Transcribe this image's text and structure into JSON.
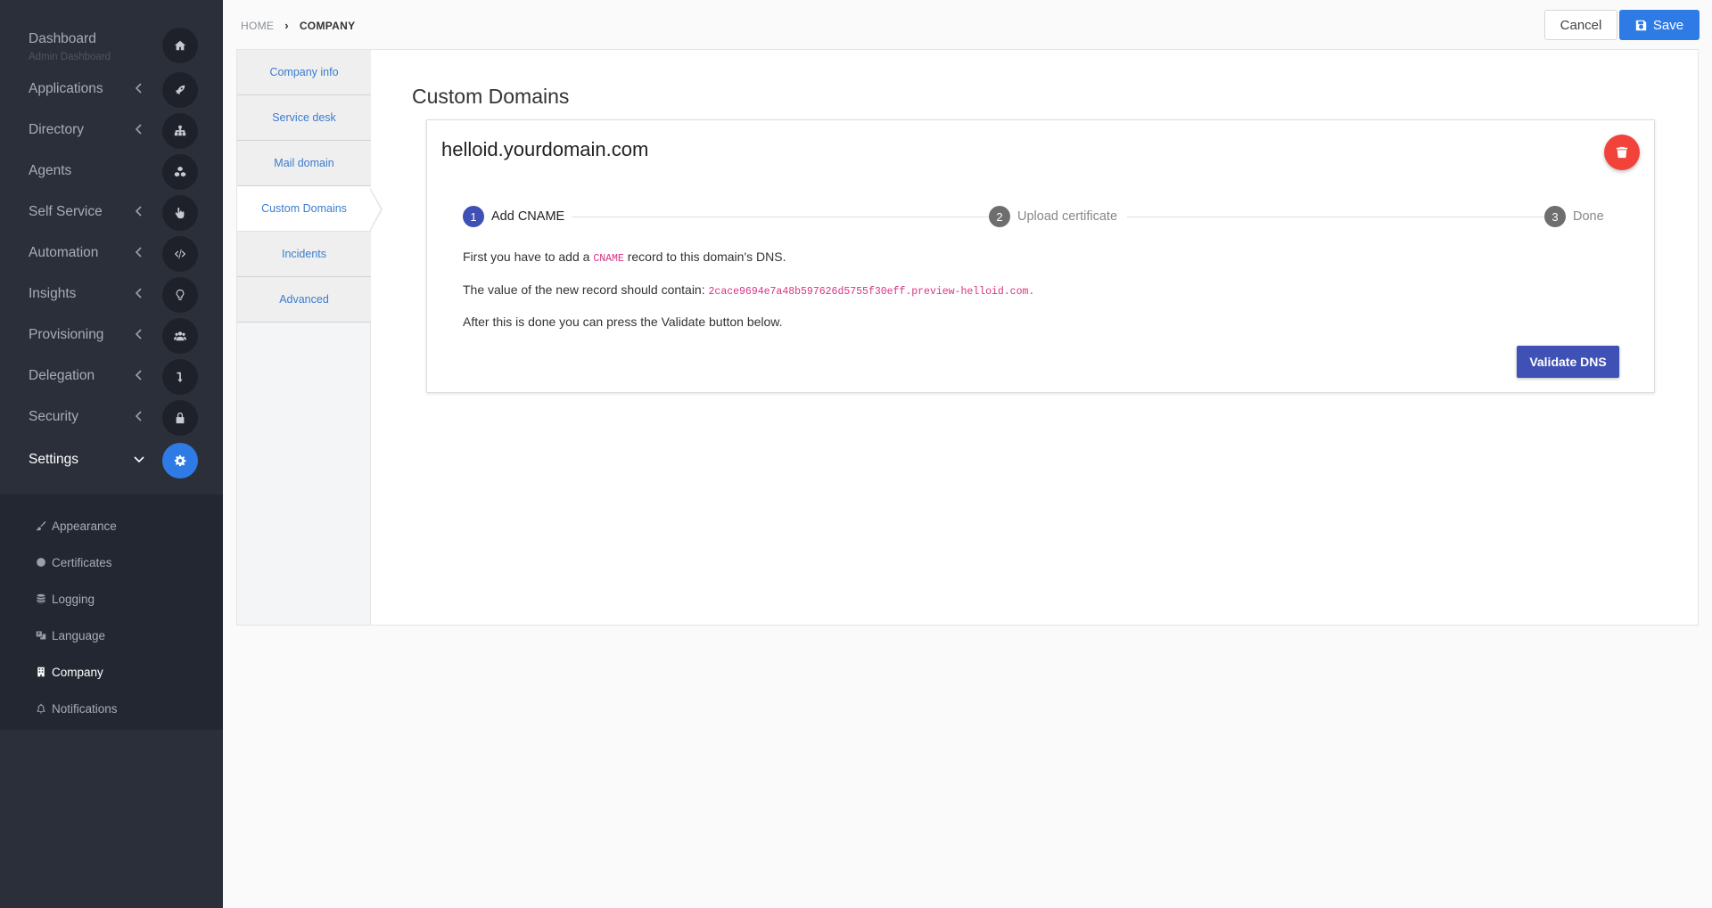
{
  "sidebar": {
    "dashboard": {
      "label": "Dashboard",
      "sub": "Admin Dashboard",
      "icon": "home-icon"
    },
    "items": [
      {
        "label": "Applications",
        "icon": "rocket-icon"
      },
      {
        "label": "Directory",
        "icon": "sitemap-icon"
      },
      {
        "label": "Agents",
        "icon": "cubes-icon"
      },
      {
        "label": "Self Service",
        "icon": "hand-pointer-icon"
      },
      {
        "label": "Automation",
        "icon": "code-icon"
      },
      {
        "label": "Insights",
        "icon": "lightbulb-icon"
      },
      {
        "label": "Provisioning",
        "icon": "users-icon"
      },
      {
        "label": "Delegation",
        "icon": "level-down-icon"
      },
      {
        "label": "Security",
        "icon": "lock-icon"
      },
      {
        "label": "Settings",
        "icon": "gear-icon"
      }
    ],
    "settings_items": [
      {
        "label": "Appearance",
        "icon": "paint-brush-icon"
      },
      {
        "label": "Certificates",
        "icon": "circle-icon"
      },
      {
        "label": "Logging",
        "icon": "database-icon"
      },
      {
        "label": "Language",
        "icon": "language-icon"
      },
      {
        "label": "Company",
        "icon": "building-icon"
      },
      {
        "label": "Notifications",
        "icon": "bell-icon"
      }
    ]
  },
  "breadcrumb": {
    "home": "HOME",
    "current": "COMPANY"
  },
  "header": {
    "cancel_label": "Cancel",
    "save_label": "Save"
  },
  "tabs": [
    "Company info",
    "Service desk",
    "Mail domain",
    "Custom Domains",
    "Incidents",
    "Advanced"
  ],
  "main": {
    "title": "Custom Domains",
    "domain": "helloid.yourdomain.com",
    "steps": [
      {
        "num": "1",
        "label": "Add CNAME"
      },
      {
        "num": "2",
        "label": "Upload certificate"
      },
      {
        "num": "3",
        "label": "Done"
      }
    ],
    "line1_pre": "First you have to add a ",
    "line1_code": "CNAME",
    "line1_post": " record to this domain's DNS.",
    "line2_pre": "The value of the new record should contain: ",
    "line2_code": "2cace9694e7a48b597626d5755f30eff.preview-helloid.com.",
    "line3": "After this is done you can press the Validate button below.",
    "validate_label": "Validate DNS"
  },
  "colors": {
    "primary": "#2f7be6",
    "indigo": "#3f51b5",
    "danger": "#f2433a",
    "sidebar": "#2b2f3a"
  }
}
